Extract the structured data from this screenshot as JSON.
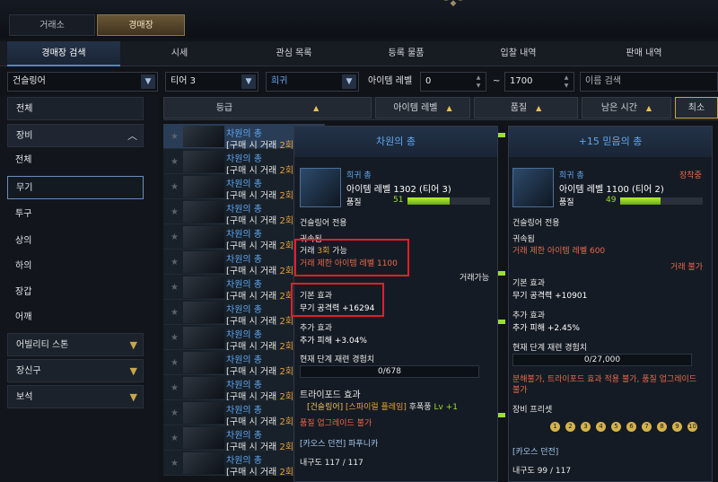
{
  "top_tabs": [
    "거래소",
    "경매장"
  ],
  "sub_tabs": [
    "경매장 검색",
    "시세",
    "관심 목록",
    "등록 물품",
    "입찰 내역",
    "판매 내역"
  ],
  "filters": {
    "class": "건슬링어",
    "tier": "티어 3",
    "grade": "희귀",
    "item_level_label": "아이템 레벨",
    "level_min": "0",
    "tilde": "~",
    "level_max": "1700",
    "name_placeholder": "이름 검색"
  },
  "sidebar": {
    "all": "전체",
    "equipment": "장비",
    "equip_items": [
      "전체",
      "무기",
      "투구",
      "상의",
      "하의",
      "장갑",
      "어깨"
    ],
    "ability_stone": "어빌리티 스톤",
    "accessory": "장신구",
    "gem": "보석"
  },
  "columns": [
    "등급",
    "아이템 레벨",
    "품질",
    "남은 시간",
    "최소"
  ],
  "rows": [
    {
      "name": "차원의 총",
      "trade_prefix": "[구매 시 거래",
      "trade_count": "2회"
    },
    {
      "name": "차원의 총",
      "trade_prefix": "[구매 시 거래",
      "trade_count": "2회"
    },
    {
      "name": "차원의 총",
      "trade_prefix": "[구매 시 거래",
      "trade_count": "2회"
    },
    {
      "name": "차원의 총",
      "trade_prefix": "[구매 시 거래",
      "trade_count": "2회"
    },
    {
      "name": "차원의 총",
      "trade_prefix": "[구매 시 거래",
      "trade_count": "2회"
    },
    {
      "name": "차원의 총",
      "trade_prefix": "[구매 시 거래",
      "trade_count": "2회"
    },
    {
      "name": "차원의 총",
      "trade_prefix": "[구매 시 거래",
      "trade_count": "2회"
    },
    {
      "name": "차원의 총",
      "trade_prefix": "[구매 시 거래",
      "trade_count": "2회"
    },
    {
      "name": "차원의 총",
      "trade_prefix": "[구매 시 거래",
      "trade_count": "2회"
    },
    {
      "name": "차원의 총",
      "trade_prefix": "[구매 시 거래",
      "trade_count": "2회"
    },
    {
      "name": "차원의 총",
      "trade_prefix": "[구매 시 거래",
      "trade_count": "2회"
    },
    {
      "name": "차원의 총",
      "trade_prefix": "[구매 시 거래",
      "trade_count": "2회"
    },
    {
      "name": "차원의 총",
      "trade_prefix": "[구매 시 거래",
      "trade_count": "2회"
    },
    {
      "name": "차원의 총",
      "trade_prefix": "[구매 시 거래",
      "trade_count": "2회"
    }
  ],
  "tooltip_left": {
    "title": "차원의 총",
    "grade_type": "희귀 총",
    "item_level": "아이템 레벨 1302 (티어 3)",
    "quality_label": "품질",
    "quality": 51,
    "class_only": "건슬링어 전용",
    "bound": "귀속됨",
    "trade_line_pre": "거래 ",
    "trade_count": "3회",
    "trade_line_post": " 가능",
    "trade_limit": "거래 제한 아이템 레벨 1100",
    "tradeable": "거래가능",
    "base_effect": "기본 효과",
    "weapon_attack": "무기 공격력 +16294",
    "extra_effect": "추가 효과",
    "extra_damage": "추가 피해 +3.04%",
    "refine_exp": "현재 단계 재련 경험치",
    "exp_value": "0/678",
    "tripod": "트라이포드 효과",
    "tripod_class": "[건슬링어]",
    "tripod_skill": "[스파이럴 플레임]",
    "tripod_name": "후폭풍",
    "tripod_lv": "Lv +1",
    "quality_upgrade": "품질 업그레이드 불가",
    "dungeon": "[카오스 던전] 파푸니카",
    "durability": "내구도 117 / 117"
  },
  "tooltip_right": {
    "title": "+15 믿음의 총",
    "grade_type": "희귀 총",
    "equipped": "장착중",
    "item_level": "아이템 레벨 1100 (티어 2)",
    "quality_label": "품질",
    "quality": 49,
    "class_only": "건슬링어 전용",
    "bound": "귀속됨",
    "trade_limit": "거래 제한 아이템 레벨 600",
    "trade_no": "거래 불가",
    "base_effect": "기본 효과",
    "weapon_attack": "무기 공격력 +10901",
    "extra_effect": "추가 효과",
    "extra_damage": "추가 피해 +2.45%",
    "refine_exp": "현재 단계 재련 경험치",
    "exp_value": "0/27,000",
    "restrictions": "분해불가, 트라이포드 효과 적용 불가, 품질 업그레이드 불가",
    "preset": "장비 프리셋",
    "preset_nums": [
      "1",
      "2",
      "3",
      "4",
      "5",
      "6",
      "7",
      "8",
      "9",
      "10"
    ],
    "dungeon": "[카오스 던전]",
    "durability": "내구도 99 / 117"
  },
  "colors": {
    "accent_blue": "#4f86c6",
    "gold": "#c8a64a",
    "red_box": "#e0202a",
    "quality_green": "#9adf30"
  }
}
